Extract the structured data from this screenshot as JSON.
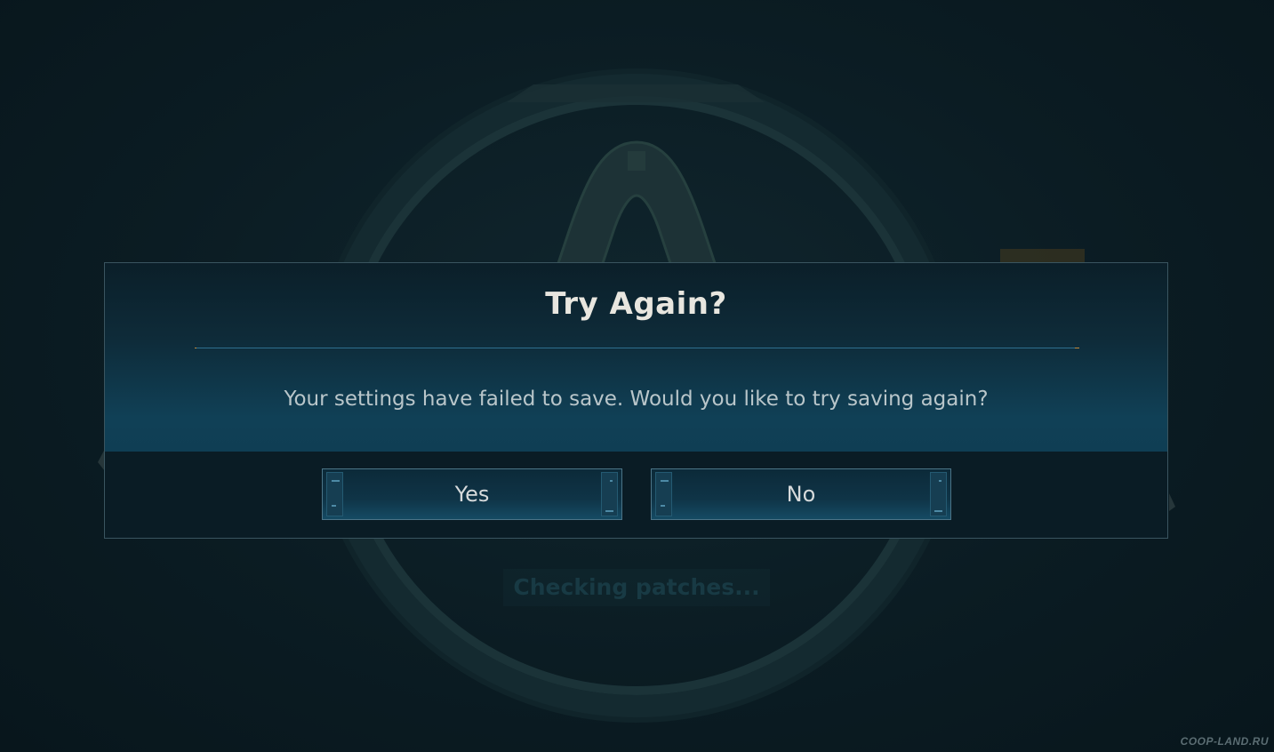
{
  "background": {
    "status_text": "Checking patches...",
    "watermark": "COOP-LAND.RU"
  },
  "dialog": {
    "title": "Try Again?",
    "message": "Your settings have failed to save. Would you like to try saving again?",
    "buttons": {
      "yes_label": "Yes",
      "no_label": "No"
    }
  },
  "colors": {
    "background": "#0a1b22",
    "dialog_border": "#3a5560",
    "title_text": "#e8e6df",
    "divider": "#2f6f8e",
    "divider_cap": "#c48a3a",
    "button_border": "#4b7487"
  },
  "icons": [
    "vault-emblem-logo"
  ]
}
